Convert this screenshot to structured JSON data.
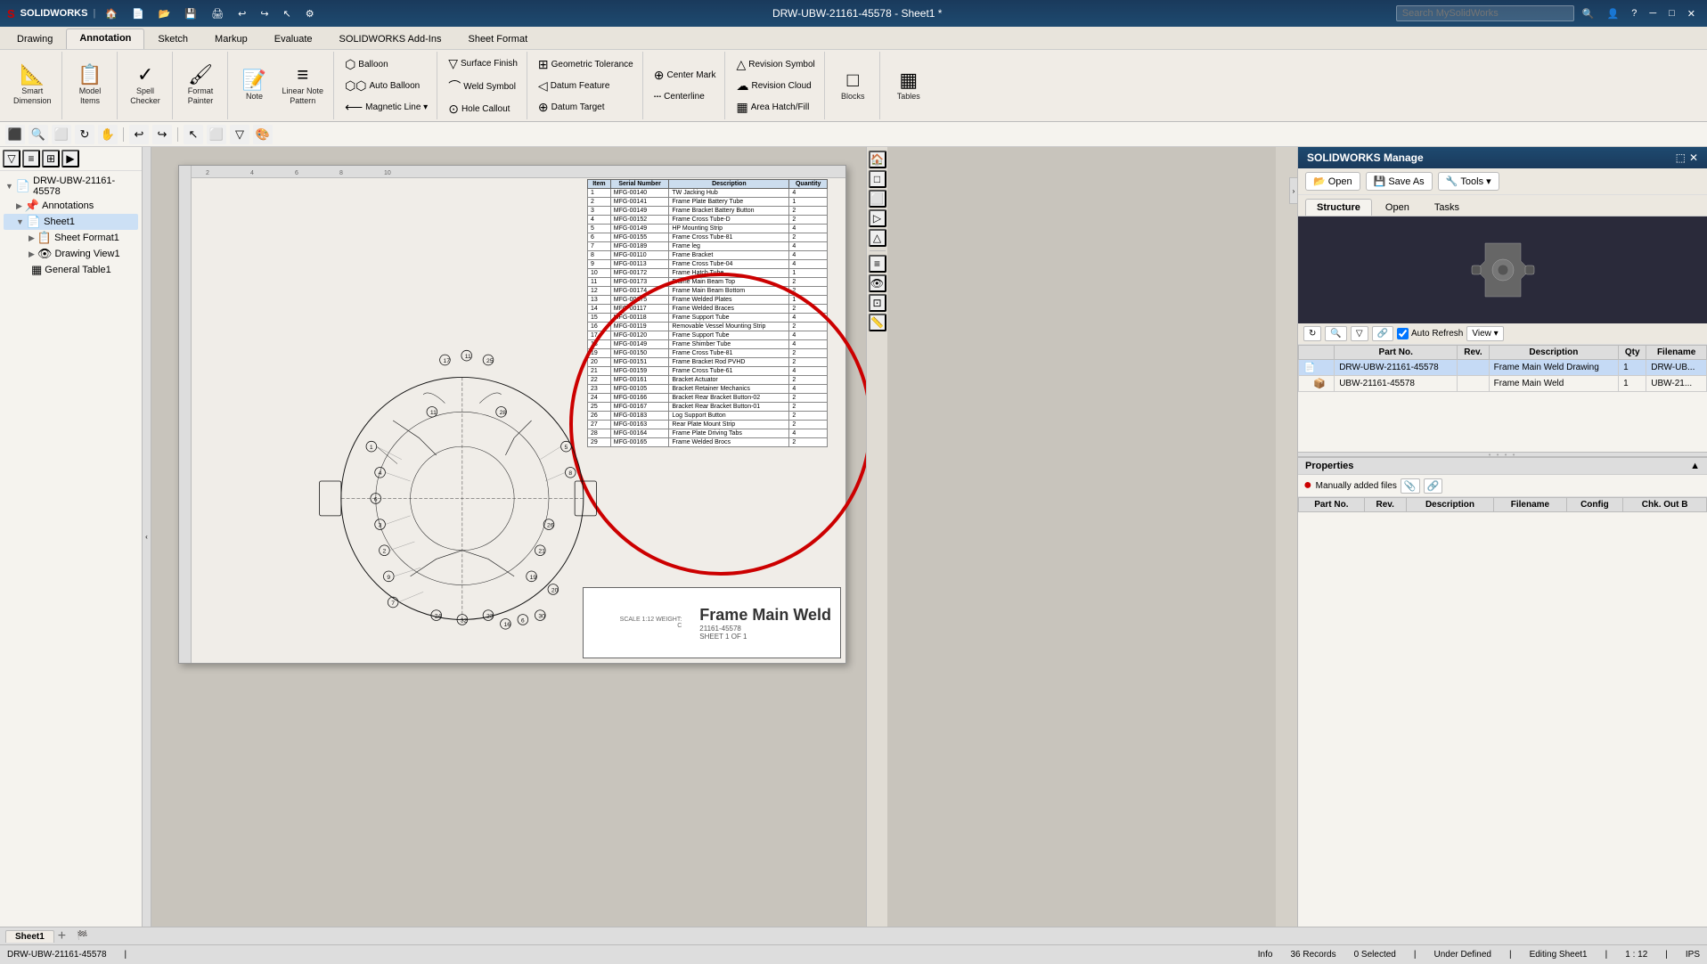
{
  "app": {
    "title": "DRW-UBW-21161-45578 - Sheet1 *",
    "logo": "SOLIDWORKS",
    "search_placeholder": "Search MySolidWorks"
  },
  "ribbon": {
    "tabs": [
      "Drawing",
      "Annotation",
      "Sketch",
      "Markup",
      "Evaluate",
      "SOLIDWORKS Add-Ins",
      "Sheet Format"
    ],
    "active_tab": "Annotation",
    "groups": {
      "smart_dimension": {
        "label": "Smart\nDimension",
        "icon": "📐"
      },
      "model_items": {
        "label": "Model\nItems",
        "icon": "📋"
      },
      "spell_checker": {
        "label": "Spell\nChecker",
        "icon": "✓"
      },
      "format_painter": {
        "label": "Format\nPainter",
        "icon": "🖌"
      },
      "note": {
        "label": "Note",
        "icon": "📝"
      },
      "linear_note": {
        "label": "Linear Note\nPattern",
        "icon": "≡"
      },
      "balloon": {
        "label": "Balloon",
        "icon": "⬡"
      },
      "auto_balloon": {
        "label": "Auto Balloon",
        "icon": "⬡⬡"
      },
      "magnetic_line": {
        "label": "Magnetic Line",
        "icon": "⟵"
      },
      "surface_finish": {
        "label": "Surface Finish",
        "icon": "▽"
      },
      "weld_symbol": {
        "label": "Weld Symbol",
        "icon": "⌒"
      },
      "hole_callout": {
        "label": "Hole Callout",
        "icon": "⊙"
      },
      "geometric_tolerance": {
        "label": "Geometric Tolerance",
        "icon": "⊞"
      },
      "datum_feature": {
        "label": "Datum Feature",
        "icon": "◁"
      },
      "datum_target": {
        "label": "Datum Target",
        "icon": "⊕"
      },
      "center_mark": {
        "label": "Center Mark",
        "icon": "⊕"
      },
      "centerline": {
        "label": "Centerline",
        "icon": "┄"
      },
      "revision_symbol": {
        "label": "Revision Symbol",
        "icon": "△"
      },
      "revision_cloud": {
        "label": "Revision Cloud",
        "icon": "☁"
      },
      "area_hatch": {
        "label": "Area Hatch/Fill",
        "icon": "▦"
      },
      "blocks": {
        "label": "Blocks",
        "icon": "□"
      },
      "tables": {
        "label": "Tables",
        "icon": "▦"
      }
    }
  },
  "feature_tree": {
    "root": "DRW-UBW-21161-45578",
    "items": [
      {
        "label": "Annotations",
        "icon": "📌",
        "level": 1
      },
      {
        "label": "Sheet1",
        "icon": "📄",
        "level": 1,
        "selected": true
      },
      {
        "label": "Sheet Format1",
        "icon": "📋",
        "level": 2
      },
      {
        "label": "Drawing View1",
        "icon": "👁",
        "level": 2
      },
      {
        "label": "General Table1",
        "icon": "▦",
        "level": 2
      }
    ]
  },
  "drawing": {
    "title": "Frame Main Weld",
    "part_number": "21161-45578",
    "scale": "1:12",
    "sheet": "SHEET 1 OF 1"
  },
  "bom": {
    "headers": [
      "Item",
      "Serial Number",
      "Description",
      "Quantity"
    ],
    "rows": [
      [
        "1",
        "MFG-00140",
        "TW Jacking Hub",
        "4"
      ],
      [
        "2",
        "MFG-00141",
        "Frame Plate Battery Tube",
        "1"
      ],
      [
        "3",
        "MFG-00149",
        "Frame Bracket Battery Button",
        "2"
      ],
      [
        "4",
        "MFG-00152",
        "Frame Cross Tube-D",
        "2"
      ],
      [
        "5",
        "MFG-00149",
        "HP Mounting Strip",
        "4"
      ],
      [
        "6",
        "MFG-00155",
        "Frame Cross Tube-81",
        "2"
      ],
      [
        "7",
        "MFG-00189",
        "Frame leg",
        "4"
      ],
      [
        "8",
        "MFG-00110",
        "Frame Bracket",
        "4"
      ],
      [
        "9",
        "MFG-00113",
        "Frame Cross Tube-04",
        "4"
      ],
      [
        "10",
        "MFG-00172",
        "Frame Hatch Tube",
        "1"
      ],
      [
        "11",
        "MFG-00173",
        "Frame Main Beam Top",
        "2"
      ],
      [
        "12",
        "MFG-00174",
        "Frame Main Beam Bottom",
        "2"
      ],
      [
        "13",
        "MFG-00175",
        "Frame Welded Plates",
        "1"
      ],
      [
        "14",
        "MFG-00117",
        "Frame Welded Braces",
        "2"
      ],
      [
        "15",
        "MFG-00118",
        "Frame Support Tube",
        "4"
      ],
      [
        "16",
        "MFG-00119",
        "Removable Vessel Mounting Strip",
        "2"
      ],
      [
        "17",
        "MFG-00120",
        "Frame Support Tube",
        "4"
      ],
      [
        "18",
        "MFG-00149",
        "Frame Shimber Tube",
        "4"
      ],
      [
        "19",
        "MFG-00150",
        "Frame Cross Tube-81",
        "2"
      ],
      [
        "20",
        "MFG-00151",
        "Frame Bracket Rod PVHD",
        "2"
      ],
      [
        "21",
        "MFG-00159",
        "Frame Cross Tube-61",
        "4"
      ],
      [
        "22",
        "MFG-00161",
        "Bracket Actuator",
        "2"
      ],
      [
        "23",
        "MFG-00105",
        "Bracket Retainer Mechanics",
        "4"
      ],
      [
        "24",
        "MFG-00166",
        "Bracket Rear Bracket Button-02",
        "2"
      ],
      [
        "25",
        "MFG-00167",
        "Bracket Rear Bracket Button-01",
        "2"
      ],
      [
        "26",
        "MFG-00183",
        "Log Support Button",
        "2"
      ],
      [
        "27",
        "MFG-00163",
        "Rear Plate Mount Strip",
        "2"
      ],
      [
        "28",
        "MFG-00164",
        "Frame Plate Driving Tabs",
        "4"
      ],
      [
        "29",
        "MFG-00165",
        "Frame Welded Brocs",
        "2"
      ]
    ]
  },
  "right_panel": {
    "title": "SOLIDWORKS Manage",
    "toolbar": {
      "open_label": "Open",
      "save_as_label": "Save As",
      "tools_label": "Tools ▾"
    },
    "tabs": [
      "Structure",
      "Open",
      "Tasks"
    ],
    "active_tab": "Structure",
    "table": {
      "headers": [
        "Part No.",
        "Rev.",
        "Description",
        "Qty",
        "Filename"
      ],
      "rows": [
        {
          "icon": "dwg",
          "name": "DRW-UBW-21161-45578",
          "rev": "",
          "desc": "Frame Main Weld Drawing",
          "qty": "1",
          "filename": "DRW-UB...",
          "expanded": true
        },
        {
          "icon": "asm",
          "name": "UBW-21161-45578",
          "rev": "",
          "desc": "Frame Main Weld",
          "qty": "1",
          "filename": "UBW-21...",
          "expanded": false
        }
      ]
    }
  },
  "properties": {
    "title": "Properties",
    "manually_added_files_label": "Manually added files",
    "table_headers": [
      "Part No.",
      "Rev.",
      "Description",
      "Filename",
      "Config",
      "Chk. Out B"
    ],
    "rows": []
  },
  "status_bar": {
    "left": "DRW-UBW-21161-45578",
    "file_state": "Under Defined",
    "editing": "Editing Sheet1",
    "scale": "1 : 12",
    "units": "IPS",
    "records": "36 Records",
    "selected": "0 Selected",
    "info": "Info"
  },
  "sheet_tabs": [
    {
      "label": "Sheet1",
      "active": true
    }
  ],
  "model_3d": {
    "description": "3D model preview - dark background"
  }
}
